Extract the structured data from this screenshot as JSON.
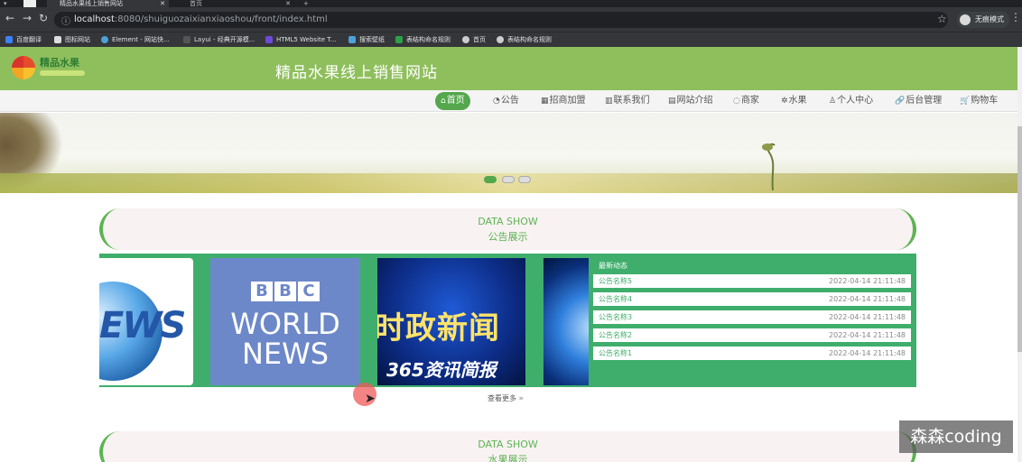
{
  "browser": {
    "tabs": [
      {
        "label": "精品水果线上销售网站",
        "active": true
      },
      {
        "label": "首页",
        "active": false
      }
    ],
    "new_tab": "+",
    "url_host": "localhost",
    "url_rest": ":8080/shuiguozaixianxiaoshou/front/index.html",
    "profile_label": "无痕模式",
    "bookmarks": [
      "百度翻译",
      "图标网站",
      "Element - 网站快...",
      "Layui - 经典开源模...",
      "HTML5 Website T...",
      "搜索壁纸",
      "表结构命名规则",
      "首页",
      "表结构命名规则"
    ]
  },
  "site": {
    "title": "精品水果线上销售网站",
    "logo_text": "精品水果"
  },
  "nav": [
    {
      "label": "首页",
      "icon": "⌂"
    },
    {
      "label": "公告",
      "icon": "◔"
    },
    {
      "label": "招商加盟",
      "icon": "▦"
    },
    {
      "label": "联系我们",
      "icon": "▥"
    },
    {
      "label": "网站介绍",
      "icon": "▤"
    },
    {
      "label": "商家",
      "icon": "◌"
    },
    {
      "label": "水果",
      "icon": "✲"
    },
    {
      "label": "个人中心",
      "icon": "♙"
    },
    {
      "label": "后台管理",
      "icon": "🔗"
    },
    {
      "label": "购物车",
      "icon": "🛒"
    }
  ],
  "section1": {
    "en": "DATA SHOW",
    "cn": "公告展示"
  },
  "thumbs": {
    "ews": "EWS",
    "bbc": [
      "B",
      "B",
      "C"
    ],
    "world": "WORLD",
    "news": "NEWS",
    "cn_big": "时政新闻",
    "cn_small": "365资讯简报"
  },
  "latest": {
    "title": "最新动态",
    "items": [
      {
        "name": "公告名称5",
        "date": "2022-04-14 21:11:48"
      },
      {
        "name": "公告名称4",
        "date": "2022-04-14 21:11:48"
      },
      {
        "name": "公告名称3",
        "date": "2022-04-14 21:11:48"
      },
      {
        "name": "公告名称2",
        "date": "2022-04-14 21:11:48"
      },
      {
        "name": "公告名称1",
        "date": "2022-04-14 21:11:48"
      }
    ]
  },
  "more_label": "查看更多",
  "section2": {
    "en": "DATA SHOW",
    "cn": "水果展示"
  },
  "watermark": "森森coding",
  "colors": {
    "header": "#8fbf5d",
    "accent": "#54a74c",
    "panel": "#3fae6c"
  }
}
